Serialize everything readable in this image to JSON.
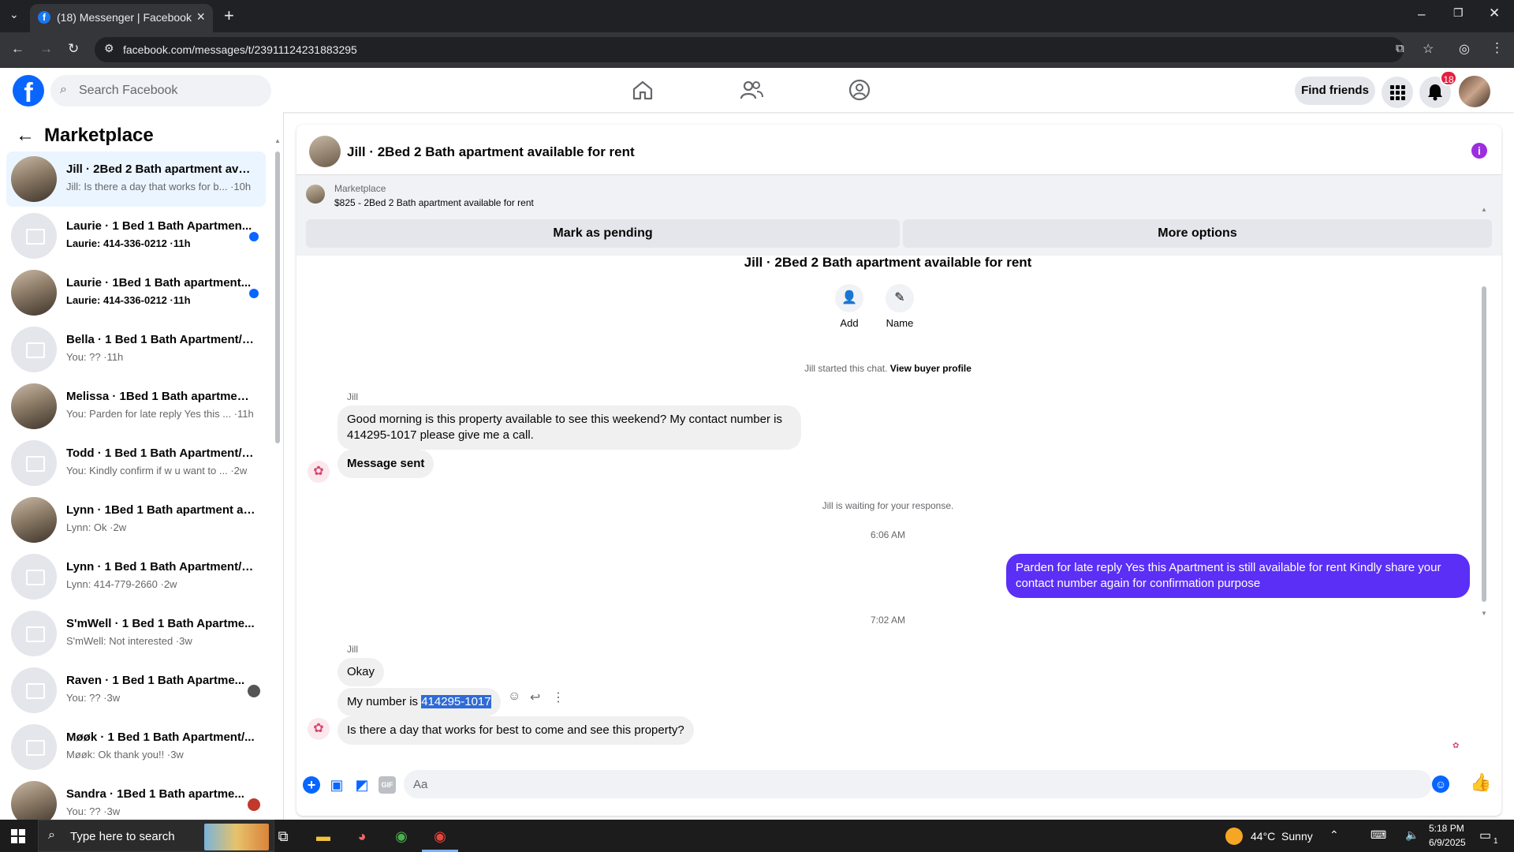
{
  "browser": {
    "tab_title": "(18) Messenger | Facebook",
    "url": "facebook.com/messages/t/23911124231883295"
  },
  "header": {
    "search_placeholder": "Search Facebook",
    "find_friends": "Find friends",
    "notification_count": "18"
  },
  "sidebar": {
    "title": "Marketplace",
    "conversations": [
      {
        "name": "Jill · 2Bed 2 Bath apartment avai...",
        "preview": "Jill: Is there a day that works for b... ·10h",
        "avatar": "room",
        "selected": true,
        "unread": false
      },
      {
        "name": "Laurie · 1 Bed 1 Bath Apartmen...",
        "preview": "Laurie: 414-336-0212 ·11h",
        "avatar": "blank",
        "unread": true
      },
      {
        "name": "Laurie · 1Bed 1 Bath apartment...",
        "preview": "Laurie: 414-336-0212 ·11h",
        "avatar": "room",
        "unread": true
      },
      {
        "name": "Bella · 1 Bed 1 Bath Apartment/c...",
        "preview": "You: ?? ·11h",
        "avatar": "blank",
        "unread": false
      },
      {
        "name": "Melissa · 1Bed 1 Bath apartment ...",
        "preview": "You: Parden for late reply Yes this ... ·11h",
        "avatar": "room",
        "unread": false
      },
      {
        "name": "Todd · 1 Bed 1 Bath Apartment/c...",
        "preview": "You: Kindly confirm if w u want to ... ·2w",
        "avatar": "blank",
        "unread": false
      },
      {
        "name": "Lynn · 1Bed 1 Bath apartment av...",
        "preview": "Lynn: Ok ·2w",
        "avatar": "room",
        "unread": false
      },
      {
        "name": "Lynn · 1 Bed 1 Bath Apartment/c...",
        "preview": "Lynn: 414-779-2660 ·2w",
        "avatar": "blank",
        "unread": false
      },
      {
        "name": "S'mWell · 1 Bed 1 Bath Apartme...",
        "preview": "S'mWell: Not interested ·3w",
        "avatar": "blank",
        "unread": false
      },
      {
        "name": "Raven · 1 Bed 1 Bath Apartme...",
        "preview": "You: ?? ·3w",
        "avatar": "blank",
        "unread": false
      },
      {
        "name": "Møøk · 1 Bed 1 Bath Apartment/...",
        "preview": "Møøk: Ok thank you!! ·3w",
        "avatar": "blank",
        "unread": false
      },
      {
        "name": "Sandra · 1Bed 1 Bath apartme...",
        "preview": "You: ?? ·3w",
        "avatar": "room",
        "unread": false
      }
    ]
  },
  "chat": {
    "title": "Jill · 2Bed 2 Bath apartment available for rent",
    "marketplace_label": "Marketplace",
    "listing": "$825 - 2Bed 2 Bath apartment available for rent",
    "mark_pending": "Mark as pending",
    "more_options": "More options",
    "intro_title": "Jill · 2Bed 2 Bath apartment available for rent",
    "add_label": "Add",
    "name_label": "Name",
    "started_text": "Jill started this chat.",
    "view_buyer": "View buyer profile",
    "sender1": "Jill",
    "msg1_line1": "Good morning is this property available to see this weekend? My contact number is",
    "msg1_line2": "414295-1017 please give me a call.",
    "msg_sent": "Message sent",
    "waiting": "Jill is waiting for your response.",
    "time1": "6:06 AM",
    "reply_line1": "Parden for late reply Yes this Apartment is still available for rent Kindly share your",
    "reply_line2": "contact number again for confirmation purpose",
    "time2": "7:02 AM",
    "sender2": "Jill",
    "msg_okay": "Okay",
    "msg_number_prefix": "My number is ",
    "msg_number": "414295-1017",
    "msg_day": "Is there a day that works for best to come and see this property?",
    "composer_placeholder": "Aa"
  },
  "taskbar": {
    "search_placeholder": "Type here to search",
    "weather": "44°C  Sunny",
    "time": "5:18 PM",
    "date": "6/9/2025",
    "notif": "1"
  }
}
